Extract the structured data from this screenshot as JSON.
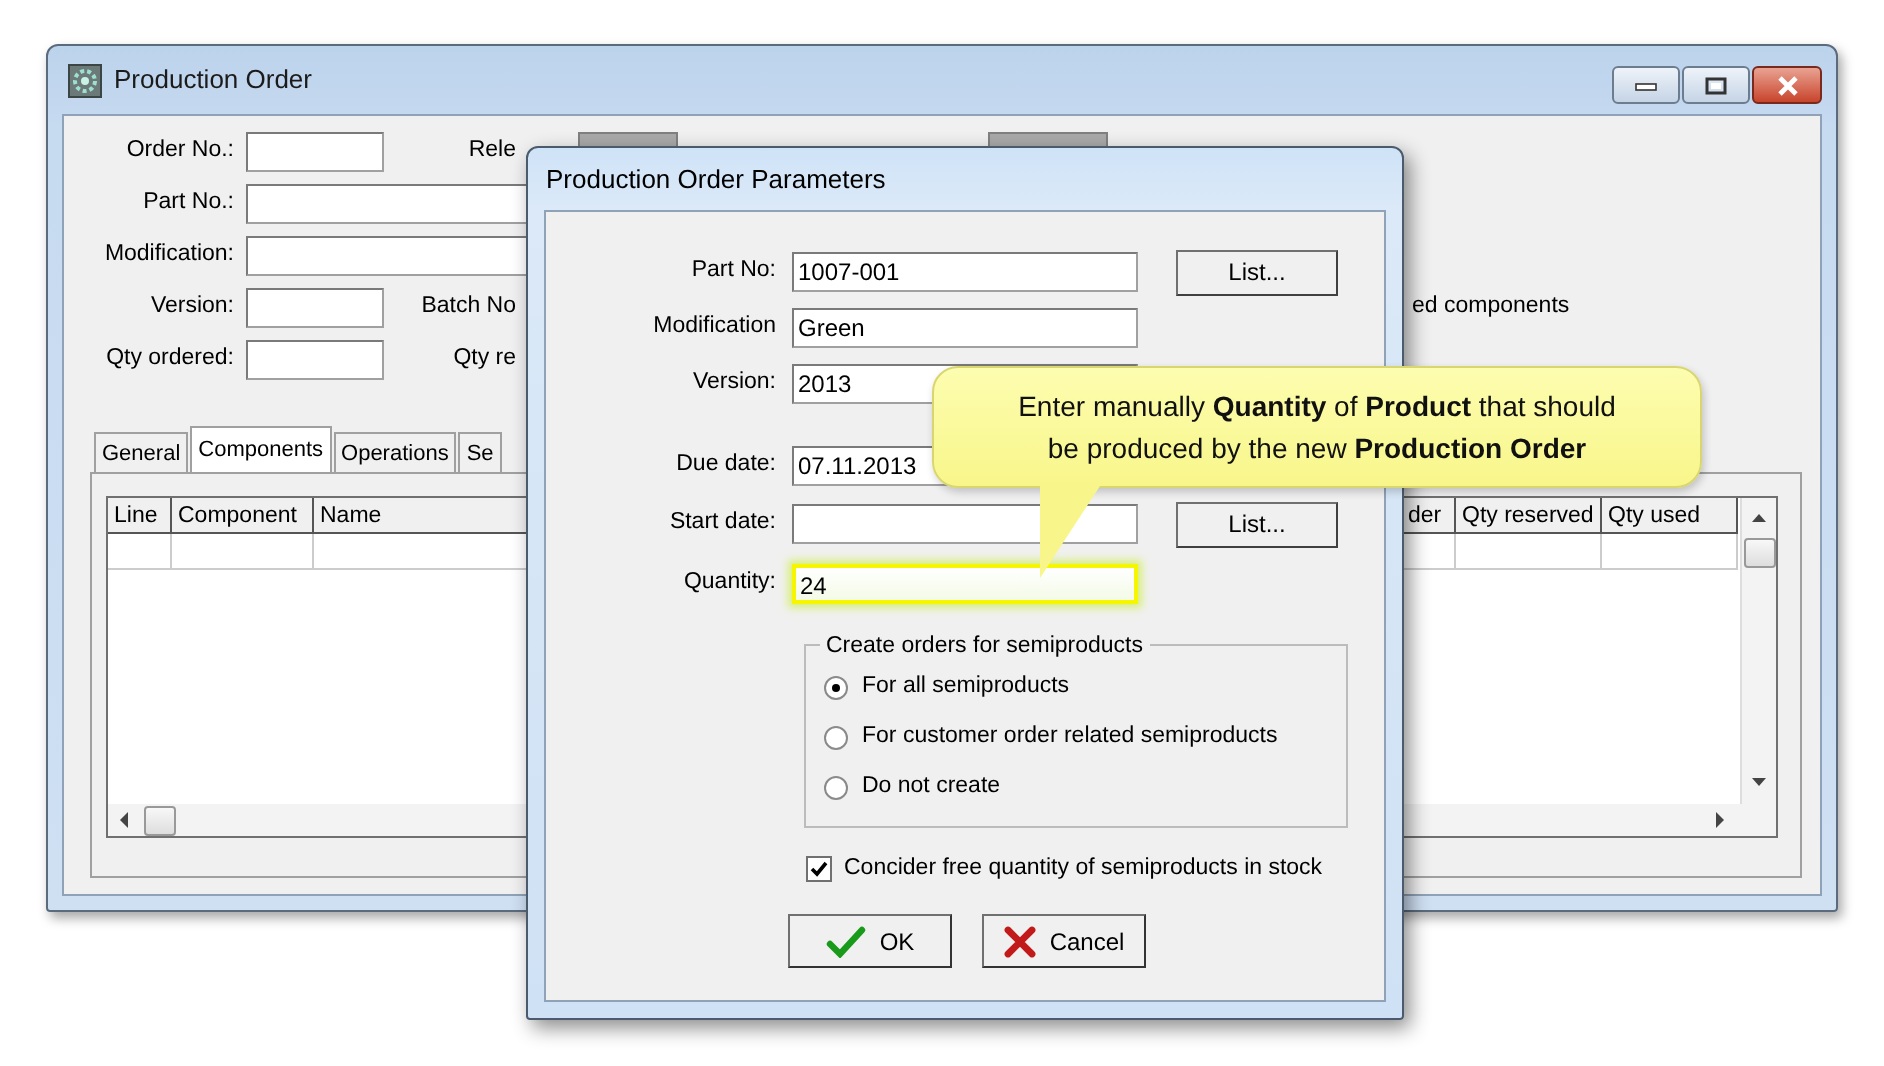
{
  "main_window": {
    "title": "Production Order",
    "form_rows": [
      {
        "label": "Order No.:",
        "kind": "short",
        "partial_label": "Rele"
      },
      {
        "label": "Part No.:",
        "kind": "long"
      },
      {
        "label": "Modification:",
        "kind": "long"
      },
      {
        "label": "Version:",
        "kind": "short",
        "partial_label": "Batch No"
      },
      {
        "label": "Qty ordered:",
        "kind": "short",
        "partial_label": "Qty re"
      }
    ],
    "side_text": "ed components",
    "tabs": [
      {
        "label": "General",
        "selected": false
      },
      {
        "label": "Components",
        "selected": true
      },
      {
        "label": "Operations",
        "selected": false
      },
      {
        "label": "Se",
        "selected": false
      }
    ],
    "table": {
      "columns": [
        "Line",
        "Component",
        "Name",
        "der",
        "Qty reserved",
        "Qty used"
      ]
    }
  },
  "dialog": {
    "title": "Production Order Parameters",
    "fields": [
      {
        "label": "Part No:",
        "value": "1007-001",
        "kind": "plain",
        "button": "List..."
      },
      {
        "label": "Modification",
        "value": "Green",
        "kind": "plain"
      },
      {
        "label": "Version:",
        "value": "2013",
        "kind": "plain"
      },
      {
        "label": "Due date:",
        "value": "07.11.2013",
        "kind": "plain"
      },
      {
        "label": "Start date:",
        "kind": "plain",
        "button": "List..."
      },
      {
        "label": "Quantity:",
        "value": "24",
        "kind": "highlighted"
      }
    ],
    "group": {
      "legend": "Create orders for semiproducts",
      "options": [
        {
          "label": "For all semiproducts",
          "selected": true
        },
        {
          "label": "For customer order related semiproducts",
          "selected": false
        },
        {
          "label": "Do not create",
          "selected": false
        }
      ]
    },
    "checkbox": {
      "label": "Concider free quantity of semiproducts in stock",
      "checked": true
    },
    "buttons": [
      {
        "label": "OK",
        "kind": "ok"
      },
      {
        "label": "Cancel",
        "kind": "cancel"
      }
    ]
  },
  "callout": {
    "lines": [
      "Enter manually **Quantity** of **Product** that should",
      "be produced by the new **Production Order**"
    ]
  }
}
